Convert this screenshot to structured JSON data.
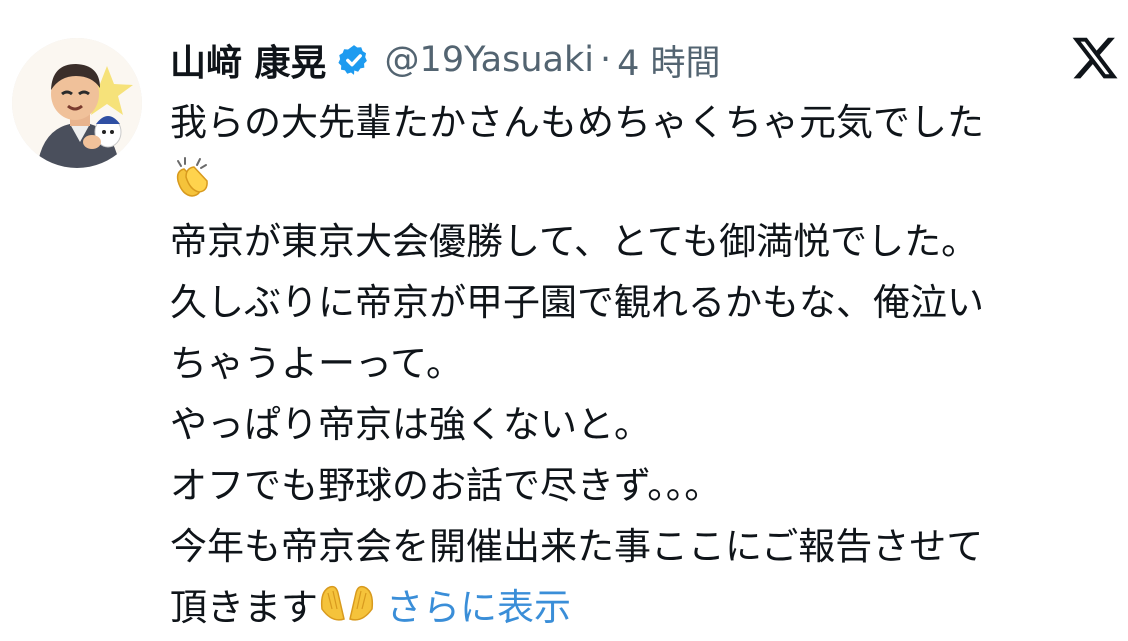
{
  "tweet": {
    "display_name": "山﨑 康晃",
    "handle": "@19Yasuaki",
    "separator": "·",
    "time": "4 時間",
    "verified_icon": "verified-badge-icon",
    "logo_icon": "x-logo-icon",
    "lines": [
      "我らの大先輩たかさんもめちゃくちゃ元気でした",
      "帝京が東京大会優勝して、とても御満悦でした。",
      "久しぶりに帝京が甲子園で観れるかもな、俺泣い",
      "ちゃうよーって。",
      "やっぱり帝京は強くないと。",
      "オフでも野球のお話で尽きず。。。",
      "今年も帝京会を開催出来た事ここにご報告させて",
      "頂きます"
    ],
    "emoji_after_line1": "clapping-hands-emoji",
    "emoji_after_last_line": "raising-hands-emoji",
    "show_more_label": "さらに表示",
    "colors": {
      "text": "#0f1419",
      "secondary": "#536471",
      "link": "#3a8ed8",
      "verified": "#1d9bf0"
    }
  }
}
